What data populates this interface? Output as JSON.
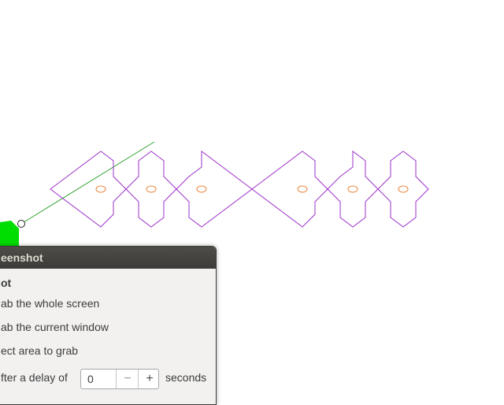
{
  "dialog": {
    "title": "Take Screenshot",
    "title_visible": "eenshot",
    "section_heading": "Take Screenshot",
    "section_heading_visible": "ot",
    "options": [
      {
        "label": "Grab the whole screen",
        "visible": "ab the whole screen"
      },
      {
        "label": "Grab the current window",
        "visible": "ab the current window"
      },
      {
        "label": "Select area to grab",
        "visible": "ect area to grab"
      }
    ],
    "delay": {
      "prefix": "Grab after a delay of",
      "prefix_visible": "fter a delay of",
      "value": "0",
      "minus": "−",
      "plus": "+",
      "suffix": "seconds"
    }
  },
  "colors": {
    "outline": "#9b30c8",
    "hole": "#e8833a",
    "guide_line": "#2fa02f",
    "cursor_fill": "#00dd00",
    "titlebar": "#3c3b37",
    "dialog_bg": "#f2f1f0"
  }
}
